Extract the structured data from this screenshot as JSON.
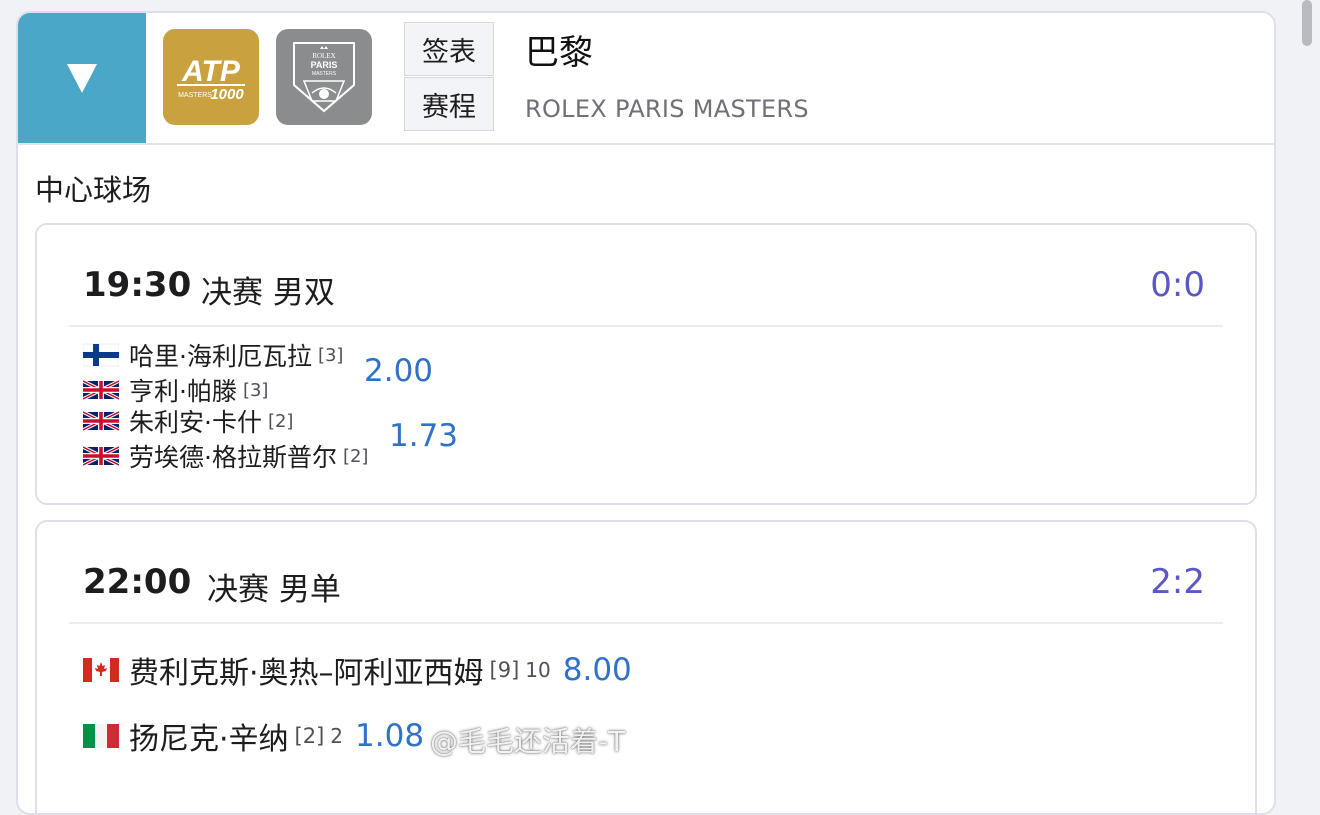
{
  "tournament": {
    "name": "巴黎",
    "subtitle": "ROLEX PARIS MASTERS",
    "draw_label": "签表",
    "schedule_label": "赛程",
    "atp_logo_text": "ATP MASTERS 1000",
    "paris_logo_text": "ROLEX PARIS MASTERS"
  },
  "court": "中心球场",
  "matches": [
    {
      "time": "19:30",
      "round": "决赛 男双",
      "score": "0:0",
      "teams": [
        {
          "odds": "2.00",
          "players": [
            {
              "flag": "FIN",
              "name": "哈里·海利厄瓦拉",
              "seed": "[3]"
            },
            {
              "flag": "GBR",
              "name": "亨利·帕滕",
              "seed": "[3]"
            }
          ]
        },
        {
          "odds": "1.73",
          "players": [
            {
              "flag": "GBR",
              "name": "朱利安·卡什",
              "seed": "[2]"
            },
            {
              "flag": "GBR",
              "name": "劳埃德·格拉斯普尔",
              "seed": "[2]"
            }
          ]
        }
      ]
    },
    {
      "time": "22:00",
      "round": "决赛 男单",
      "score": "2:2",
      "players": [
        {
          "flag": "CAN",
          "name": "费利克斯·奥热–阿利亚西姆",
          "seed": "[9]",
          "sets": "10",
          "odds": "8.00"
        },
        {
          "flag": "ITA",
          "name": "扬尼克·辛纳",
          "seed": "[2]",
          "sets": "2",
          "odds": "1.08"
        }
      ]
    }
  ],
  "watermark": "@毛毛还活着-T",
  "colors": {
    "collapse_bg": "#4aa7c8",
    "atp_gold": "#c9a23f",
    "paris_grey": "#8b8c8e",
    "score": "#5b57c8",
    "odds": "#2f72c7"
  }
}
